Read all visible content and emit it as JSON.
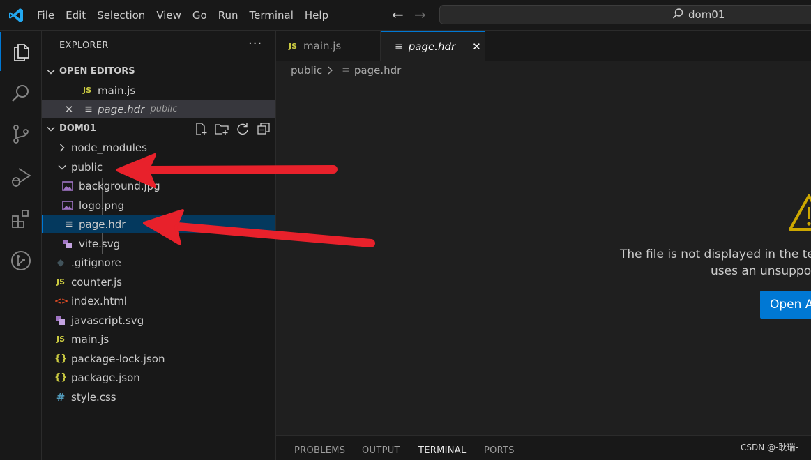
{
  "menu": [
    "File",
    "Edit",
    "Selection",
    "View",
    "Go",
    "Run",
    "Terminal",
    "Help"
  ],
  "command_center": {
    "text": "dom01"
  },
  "explorer": {
    "title": "EXPLORER",
    "more": "···",
    "open_editors": {
      "title": "OPEN EDITORS",
      "items": [
        {
          "icon": "JS",
          "name": "main.js",
          "dir": ""
        },
        {
          "icon": "≡",
          "name": "page.hdr",
          "dir": "public"
        }
      ]
    },
    "folder": {
      "title": "DOM01",
      "items": [
        {
          "name": "node_modules",
          "type": "folder-collapsed",
          "icon": "",
          "indent": 1
        },
        {
          "name": "public",
          "type": "folder-expanded",
          "icon": "",
          "indent": 1
        },
        {
          "name": "background.jpg",
          "type": "image",
          "icon": "image-icon",
          "indent": 2
        },
        {
          "name": "logo.png",
          "type": "image",
          "icon": "image-icon",
          "indent": 2
        },
        {
          "name": "page.hdr",
          "type": "text",
          "icon": "≡",
          "indent": 2
        },
        {
          "name": "vite.svg",
          "type": "svg",
          "icon": "svg-icon",
          "indent": 2
        },
        {
          "name": ".gitignore",
          "type": "git",
          "icon": "◆",
          "indent": 1
        },
        {
          "name": "counter.js",
          "type": "js",
          "icon": "JS",
          "indent": 1
        },
        {
          "name": "index.html",
          "type": "html",
          "icon": "<>",
          "indent": 1
        },
        {
          "name": "javascript.svg",
          "type": "svg",
          "icon": "svg-icon",
          "indent": 1
        },
        {
          "name": "main.js",
          "type": "js",
          "icon": "JS",
          "indent": 1
        },
        {
          "name": "package-lock.json",
          "type": "json",
          "icon": "{}",
          "indent": 1
        },
        {
          "name": "package.json",
          "type": "json",
          "icon": "{}",
          "indent": 1
        },
        {
          "name": "style.css",
          "type": "css",
          "icon": "#",
          "indent": 1
        }
      ]
    }
  },
  "tabs": [
    {
      "icon": "JS",
      "label": "main.js",
      "active": false
    },
    {
      "icon": "≡",
      "label": "page.hdr",
      "active": true,
      "close": "✕"
    }
  ],
  "breadcrumb": {
    "folder": "public",
    "file": "page.hdr"
  },
  "editor": {
    "message_line1": "The file is not displayed in the text e",
    "message_line2": "uses an unsupporte",
    "button": "Open A"
  },
  "panel": {
    "tabs": [
      "PROBLEMS",
      "OUTPUT",
      "TERMINAL",
      "PORTS"
    ],
    "active": "TERMINAL"
  },
  "watermark": "CSDN @-耿瑞-",
  "colors": {
    "accent": "#0078d4",
    "js": "#cbcb41",
    "arrow": "#e8212b",
    "warning": "#cca700"
  }
}
